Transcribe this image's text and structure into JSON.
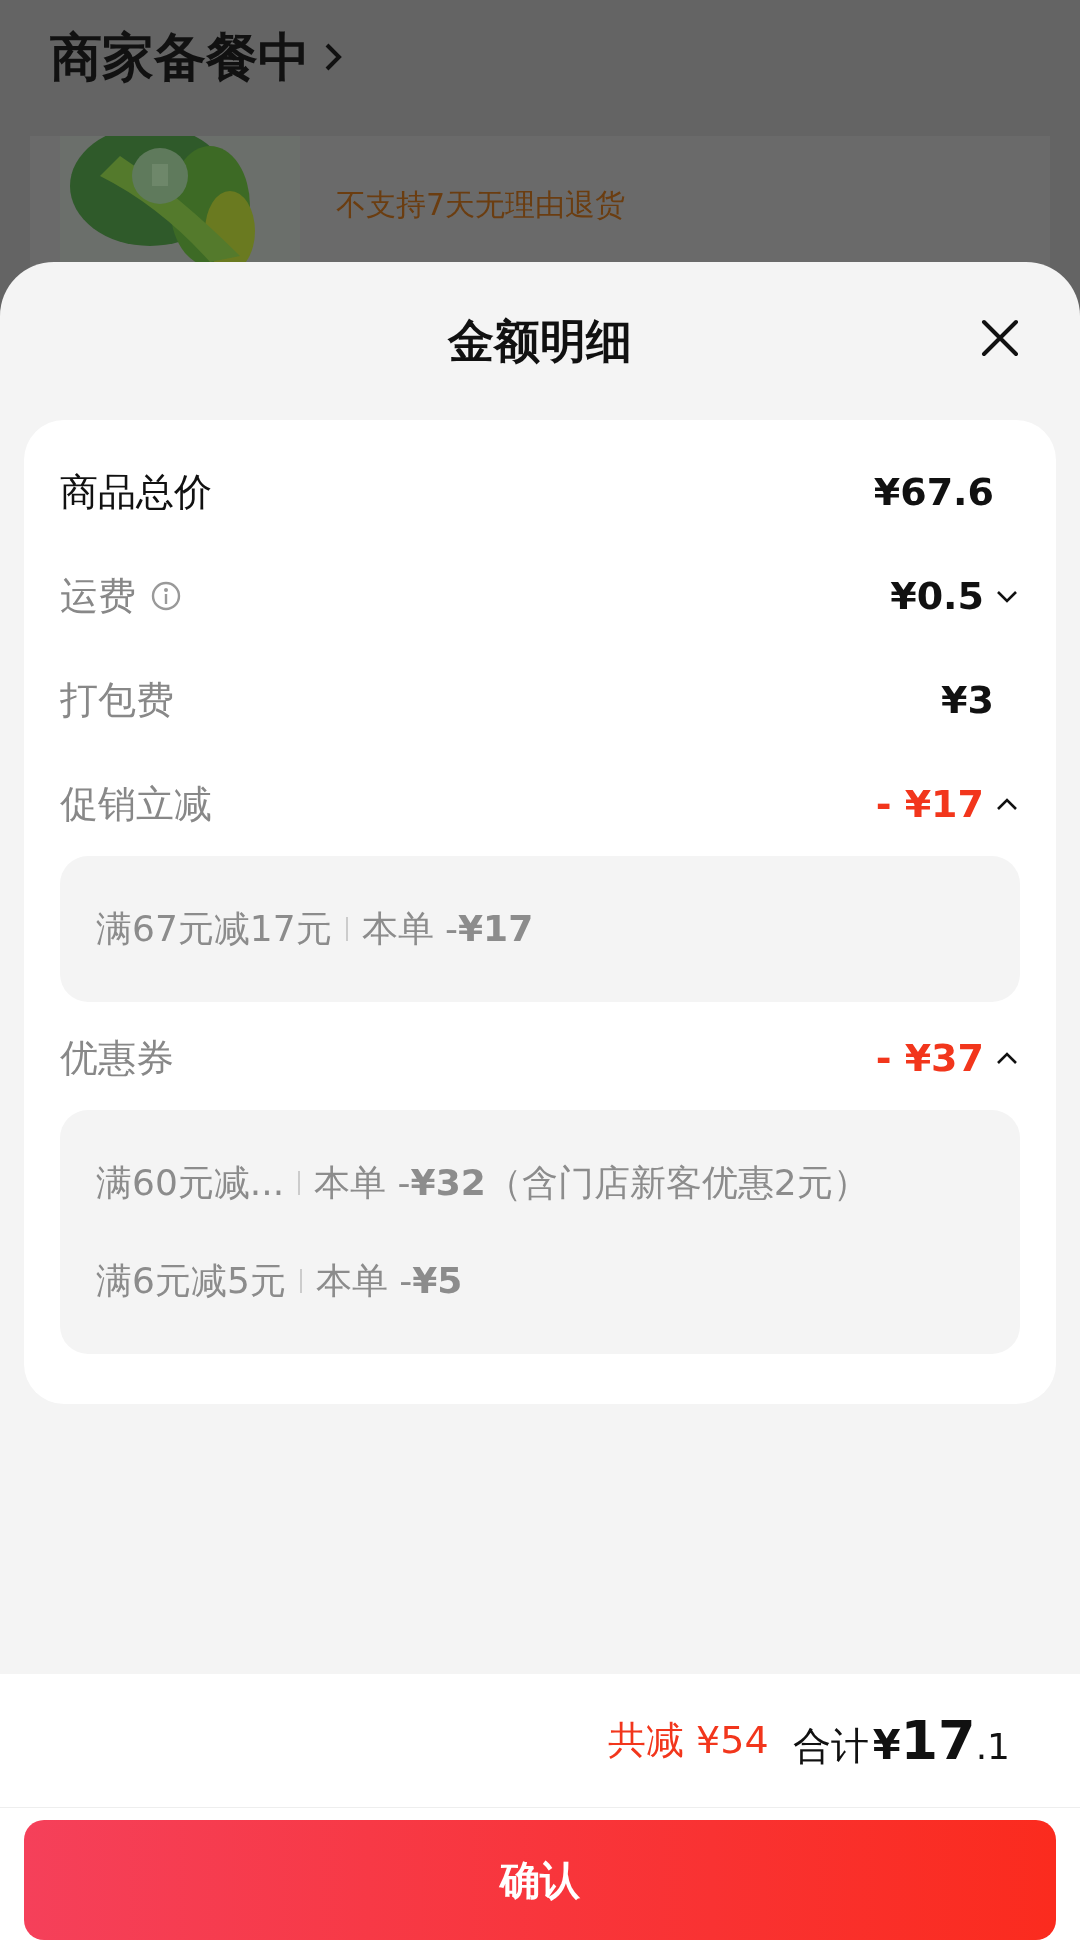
{
  "background": {
    "status_title": "商家备餐中",
    "product_note": "不支持7天无理由退货"
  },
  "sheet": {
    "title": "金额明细",
    "rows": [
      {
        "kind": "total",
        "label": "商品总价",
        "value": "¥67.6"
      },
      {
        "kind": "fee",
        "label": "运费",
        "info": true,
        "value": "¥0.5",
        "expanded": false
      },
      {
        "kind": "fee",
        "label": "打包费",
        "value": "¥3"
      },
      {
        "kind": "discount",
        "label": "促销立减",
        "value": "- ¥17",
        "expanded": true,
        "details": [
          {
            "rule": "满67元减17元",
            "amount": "本单 -**¥17**"
          }
        ]
      },
      {
        "kind": "discount",
        "label": "优惠券",
        "value": "- ¥37",
        "expanded": true,
        "details": [
          {
            "rule": "满60元减...",
            "amount": "本单 -**¥32**（含门店新客优惠2元）"
          },
          {
            "rule": "满6元减5元",
            "amount": "本单 -**¥5**"
          }
        ]
      }
    ]
  },
  "footer": {
    "saved": "共减 ¥54",
    "total_label": "合计",
    "currency": "¥",
    "total_integer": "17",
    "total_decimal": ".1",
    "confirm_button": "确认"
  }
}
